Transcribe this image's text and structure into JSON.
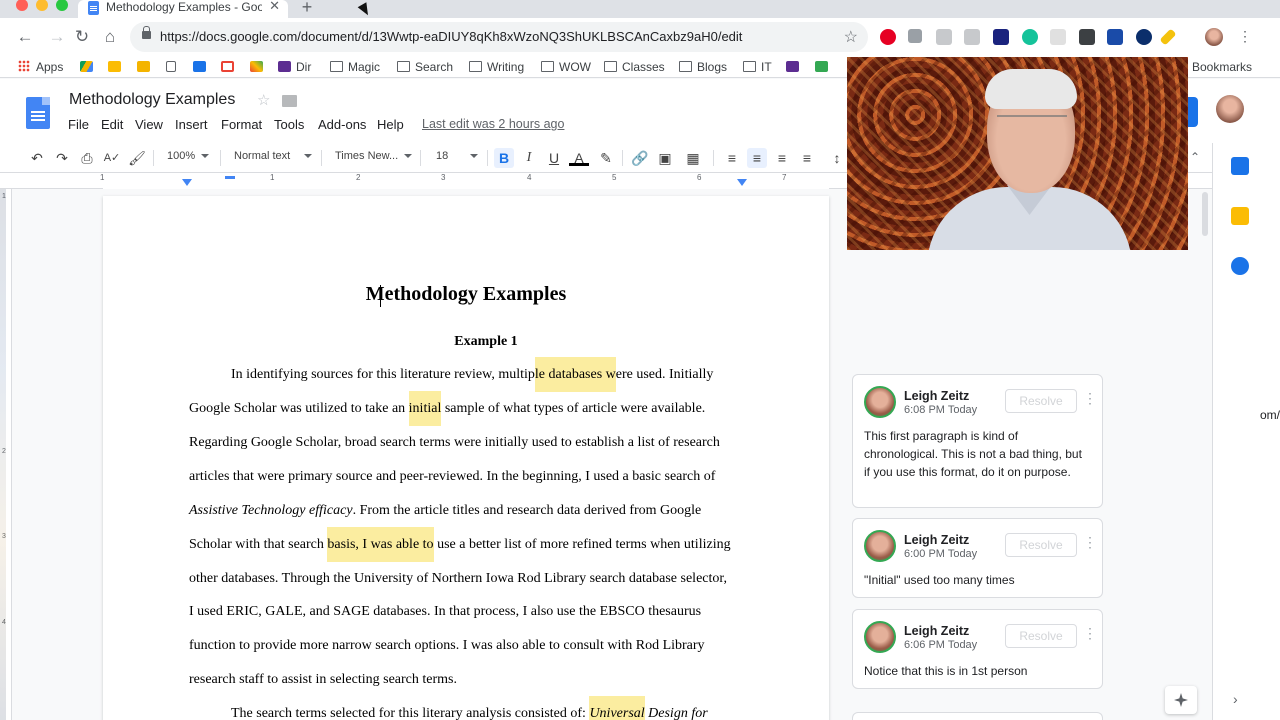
{
  "browser": {
    "tab_title": "Methodology Examples - Goog",
    "tab_close": "✕",
    "new_tab": "+",
    "url": "https://docs.google.com/document/d/13Wwtp-eaDIUY8qKh8xWzoNQ3ShUKLBSCAnCaxbz9aH0/edit",
    "bookmarks": [
      "Apps",
      "",
      "",
      "",
      "",
      "",
      "",
      "Dir",
      "Magic",
      "Search",
      "Writing",
      "WOW",
      "Classes",
      "Blogs",
      "IT",
      "",
      ""
    ],
    "bookmarks_overflow": "Bookmarks"
  },
  "docs": {
    "title": "Methodology Examples",
    "menus": [
      "File",
      "Edit",
      "View",
      "Insert",
      "Format",
      "Tools",
      "Add-ons",
      "Help"
    ],
    "last_edit": "Last edit was 2 hours ago"
  },
  "toolbar": {
    "zoom": "100%",
    "style": "Normal text",
    "font": "Times New...",
    "size": "18",
    "bold": "B",
    "italic": "I",
    "underline": "U",
    "text_color": "A"
  },
  "ruler": {
    "ticks": [
      "1",
      "1",
      "2",
      "3",
      "4",
      "5",
      "6",
      "7"
    ],
    "vticks": [
      "1",
      "2",
      "3",
      "4"
    ]
  },
  "document": {
    "heading": "Methodology Examples",
    "subheading": "Example 1",
    "lines": [
      {
        "parts": [
          {
            "t": "In identifying sources for this literature review, multip"
          },
          {
            "t": "le databases w",
            "hl": true
          },
          {
            "t": "ere used.  Initially"
          }
        ]
      },
      {
        "parts": [
          {
            "t": "Google Scholar was utilized to take an "
          },
          {
            "t": "initial",
            "hl": true
          },
          {
            "t": " sample of what types of article were available."
          }
        ]
      },
      {
        "parts": [
          {
            "t": "Regarding Google Scholar, broad search terms were initially used to establish a list of research"
          }
        ]
      },
      {
        "parts": [
          {
            "t": "articles that were primary source and peer-reviewed.  In the beginning, I used a basic search of"
          }
        ]
      },
      {
        "parts": [
          {
            "t": "Assistive Technology efficacy",
            "it": true
          },
          {
            "t": ".  From the article titles and research data derived from Google"
          }
        ]
      },
      {
        "parts": [
          {
            "t": "Scholar with that search "
          },
          {
            "t": "basis, I was able to",
            "hl": true
          },
          {
            "t": " use a better list of more refined terms when utilizing"
          }
        ]
      },
      {
        "parts": [
          {
            "t": "other databases.  Through the University of Northern Iowa Rod Library search database selector,"
          }
        ]
      },
      {
        "parts": [
          {
            "t": "I used ERIC, GALE, and SAGE databases.  In that process, I also use the EBSCO thesaurus"
          }
        ]
      },
      {
        "parts": [
          {
            "t": "function to provide more narrow search options.  I was also able to consult with Rod Library"
          }
        ]
      },
      {
        "parts": [
          {
            "t": "research staff to assist in selecting search terms."
          }
        ]
      },
      {
        "parts": [
          {
            "t": "The search terms selected for this literary analysis consisted of: "
          },
          {
            "t": "Universal",
            "hl": true,
            "it": true
          },
          {
            "t": " Design for",
            "it": true
          }
        ]
      }
    ]
  },
  "comments": [
    {
      "author": "Leigh Zeitz",
      "time": "6:08 PM Today",
      "resolve": "Resolve",
      "more": "⋮",
      "body": "This first paragraph is kind of chronological. This is not a bad thing, but if you use this format, do it on purpose."
    },
    {
      "author": "Leigh Zeitz",
      "time": "6:00 PM Today",
      "resolve": "Resolve",
      "more": "⋮",
      "body": "\"Initial\" used too many times"
    },
    {
      "author": "Leigh Zeitz",
      "time": "6:06 PM Today",
      "resolve": "Resolve",
      "more": "⋮",
      "body": "Notice that this is in 1st person"
    }
  ],
  "edge_peek": "om/",
  "colors": {
    "accent": "#1a73e8",
    "highlight": "#fbeda0",
    "docs_blue": "#4285f4"
  }
}
